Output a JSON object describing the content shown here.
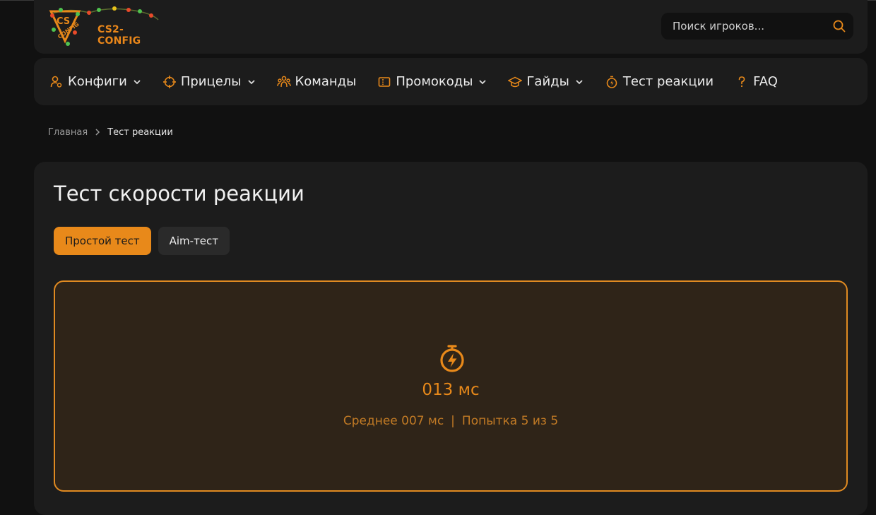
{
  "header": {
    "logo_text": "CS2-CONFIG",
    "search_placeholder": "Поиск игроков..."
  },
  "nav": {
    "items": [
      {
        "label": "Конфиги",
        "icon": "user-config-icon",
        "has_dropdown": true
      },
      {
        "label": "Прицелы",
        "icon": "crosshair-icon",
        "has_dropdown": true
      },
      {
        "label": "Команды",
        "icon": "team-icon",
        "has_dropdown": false
      },
      {
        "label": "Промокоды",
        "icon": "ticket-icon",
        "has_dropdown": true
      },
      {
        "label": "Гайды",
        "icon": "graduation-cap-icon",
        "has_dropdown": true
      },
      {
        "label": "Тест реакции",
        "icon": "stopwatch-icon",
        "has_dropdown": false
      },
      {
        "label": "FAQ",
        "icon": "question-icon",
        "has_dropdown": false
      }
    ]
  },
  "breadcrumb": {
    "home": "Главная",
    "current": "Тест реакции"
  },
  "main": {
    "title": "Тест скорости реакции",
    "tabs": [
      {
        "label": "Простой тест",
        "active": true
      },
      {
        "label": "Aim-тест",
        "active": false
      }
    ],
    "test": {
      "result": "013 мс",
      "average": "Среднее 007 мс",
      "divider": "|",
      "attempt": "Попытка 5 из 5"
    }
  },
  "colors": {
    "accent": "#e8891a",
    "background": "#111111",
    "panel": "#1c1c1c",
    "test_area_bg": "#2f2418"
  }
}
